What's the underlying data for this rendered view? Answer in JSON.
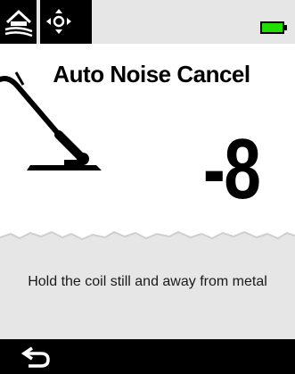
{
  "status_bar": {
    "mode_icon": "field-mode-icon",
    "pinpoint_icon": "pinpoint-move-icon",
    "battery_icon": "battery-icon",
    "battery_color": "#22dd00",
    "battery_level": 1.0
  },
  "screen": {
    "title": "Auto Noise Cancel",
    "value": "-8",
    "message": "Hold the coil still and away from metal",
    "illustration_icon": "search-coil-icon"
  },
  "bottom_bar": {
    "back_icon": "back-arrow-icon"
  }
}
